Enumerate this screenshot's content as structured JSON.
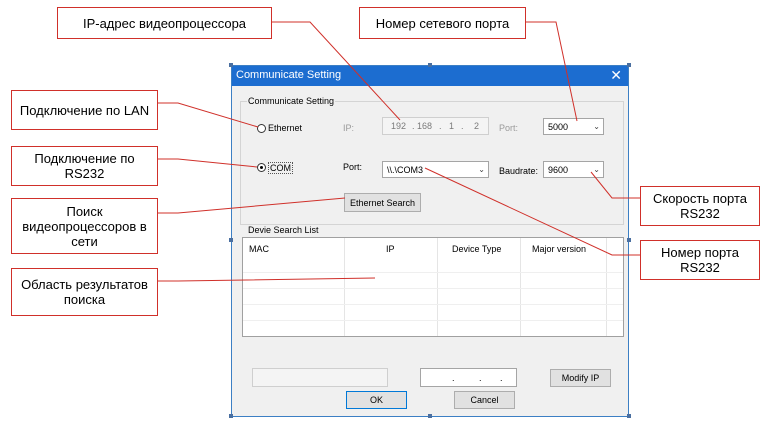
{
  "annotations": {
    "ip_address": "IP-адрес видеопроцессора",
    "network_port": "Номер сетевого порта",
    "lan": "Подключение по LAN",
    "rs232": "Подключение по RS232",
    "search": "Поиск видеопроцессоров в сети",
    "results": "Область результатов поиска",
    "baud_speed": "Скорость порта RS232",
    "port_number": "Номер порта RS232",
    "accent_color": "#d0302a"
  },
  "dialog": {
    "title": "Communicate Setting",
    "close_icon": "close-icon",
    "group_label": "Communicate Setting",
    "ethernet_label": "Ethernet",
    "ip_label": "IP:",
    "ip_parts": [
      "192",
      "168",
      "1",
      "2"
    ],
    "port_label_eth": "Port:",
    "eth_port_value": "5000",
    "com_label": "COM",
    "port_label_com": "Port:",
    "com_port_value": "\\\\.\\COM3",
    "baud_label": "Baudrate:",
    "baud_value": "9600",
    "search_button": "Ethernet Search",
    "list_group_label": "Devie Search List",
    "columns": [
      "MAC",
      "IP",
      "Device Type",
      "Major version"
    ],
    "ip_dots": [
      ".",
      ".",
      "."
    ],
    "modify_button": "Modify IP",
    "ok_button": "OK",
    "cancel_button": "Cancel",
    "selected_mode": "COM",
    "titlebar_color": "#1c6dd0"
  }
}
